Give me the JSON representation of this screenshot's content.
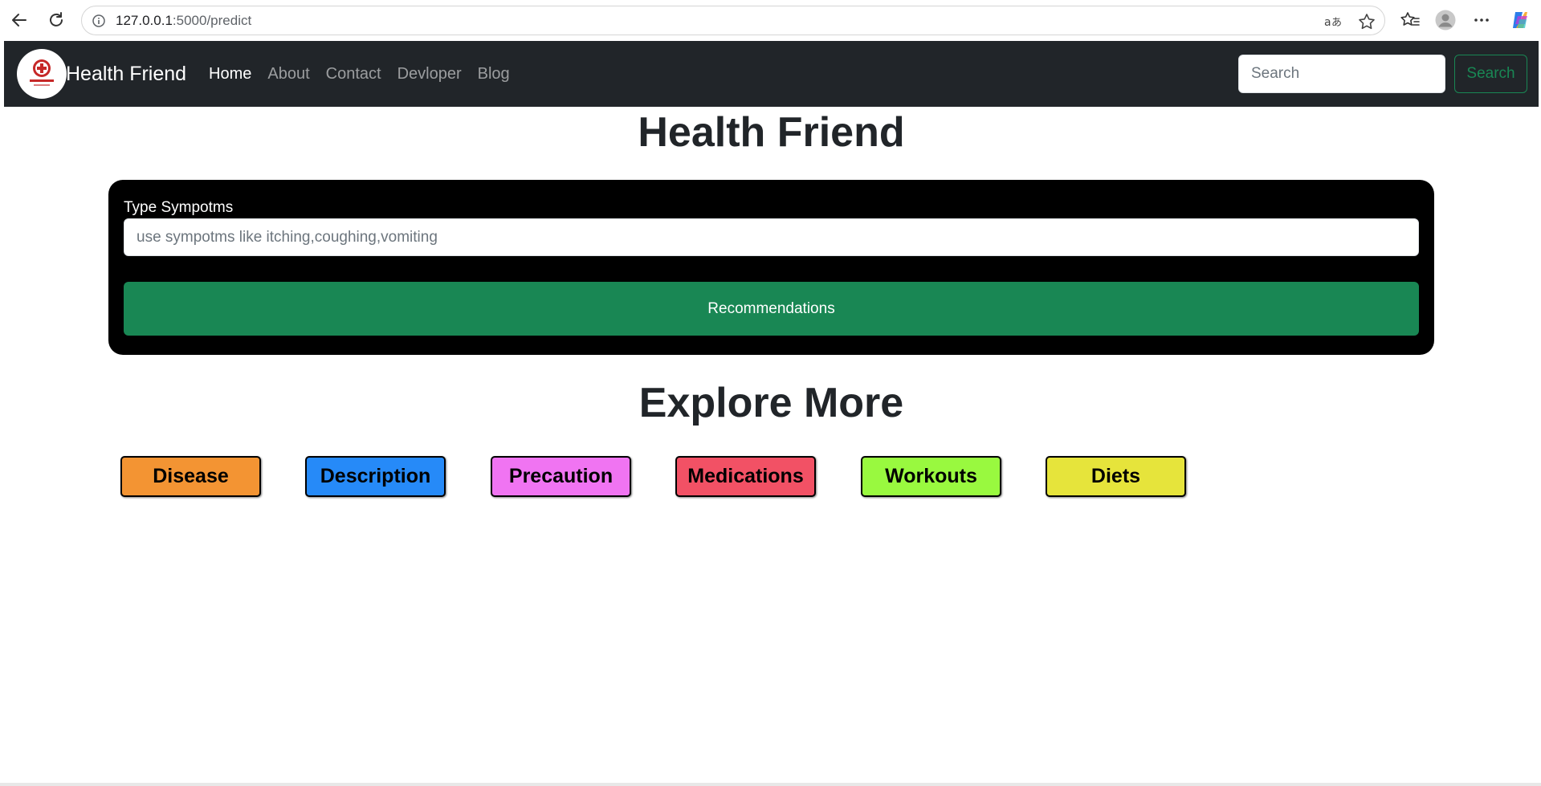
{
  "browser": {
    "url_host": "127.0.0.1",
    "url_rest": ":5000/predict",
    "icons": [
      "back-icon",
      "reload-icon",
      "info-icon",
      "read-aloud-icon",
      "favorite-star-icon",
      "favorites-icon",
      "profile-icon",
      "more-icon",
      "copilot-icon"
    ]
  },
  "navbar": {
    "brand": "Health Friend",
    "links": [
      {
        "label": "Home",
        "active": true
      },
      {
        "label": "About",
        "active": false
      },
      {
        "label": "Contact",
        "active": false
      },
      {
        "label": "Devloper",
        "active": false
      },
      {
        "label": "Blog",
        "active": false
      }
    ],
    "search_placeholder": "Search",
    "search_button": "Search",
    "logo_icon": "health-care-logo-icon"
  },
  "main": {
    "title": "Health Friend",
    "symptom_label": "Type Sympotms",
    "symptom_placeholder": "use sympotms like itching,coughing,vomiting",
    "submit_label": "Recommendations"
  },
  "explore": {
    "title": "Explore More",
    "buttons": [
      {
        "label": "Disease",
        "color": "#f39433"
      },
      {
        "label": "Description",
        "color": "#268af8"
      },
      {
        "label": "Precaution",
        "color": "#f074f2"
      },
      {
        "label": "Medications",
        "color": "#f25165"
      },
      {
        "label": "Workouts",
        "color": "#99f93f"
      },
      {
        "label": "Diets",
        "color": "#e6e43b"
      }
    ]
  },
  "colors": {
    "navbar_bg": "#212529",
    "accent_green": "#198754",
    "symptom_box_bg": "#000000"
  }
}
